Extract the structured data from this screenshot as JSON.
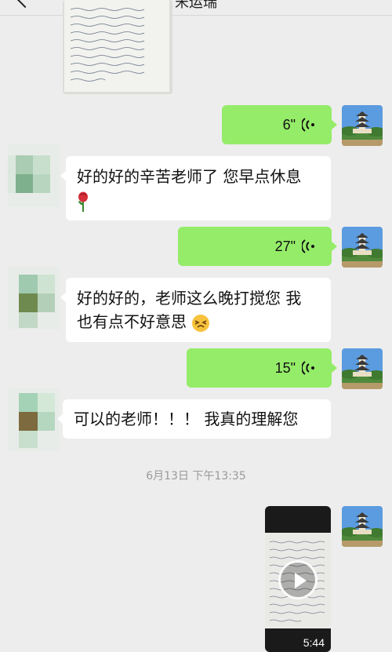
{
  "header": {
    "title": "宋运瑞"
  },
  "messages": [
    {
      "type": "image",
      "sender": "other"
    },
    {
      "type": "voice",
      "sender": "self",
      "duration": "6\""
    },
    {
      "type": "text",
      "sender": "other",
      "text": "好的好的辛苦老师了 您早点休息",
      "emoji": "rose"
    },
    {
      "type": "voice",
      "sender": "self",
      "duration": "27\""
    },
    {
      "type": "text",
      "sender": "other",
      "line1": "好的好的，老师这么晚打搅您 我",
      "line2": "也有点不好意思",
      "emoji": "persevering-face"
    },
    {
      "type": "voice",
      "sender": "self",
      "duration": "15\""
    },
    {
      "type": "text",
      "sender": "other",
      "text": "可以的老师！！！ 我真的理解您"
    },
    {
      "type": "timestamp",
      "text": "6月13日 下午13:35"
    },
    {
      "type": "video",
      "sender": "self",
      "duration": "5:44"
    }
  ],
  "colors": {
    "background": "#ededed",
    "sent_bubble": "#95ec69",
    "received_bubble": "#ffffff",
    "timestamp_text": "#9a9a9a"
  }
}
